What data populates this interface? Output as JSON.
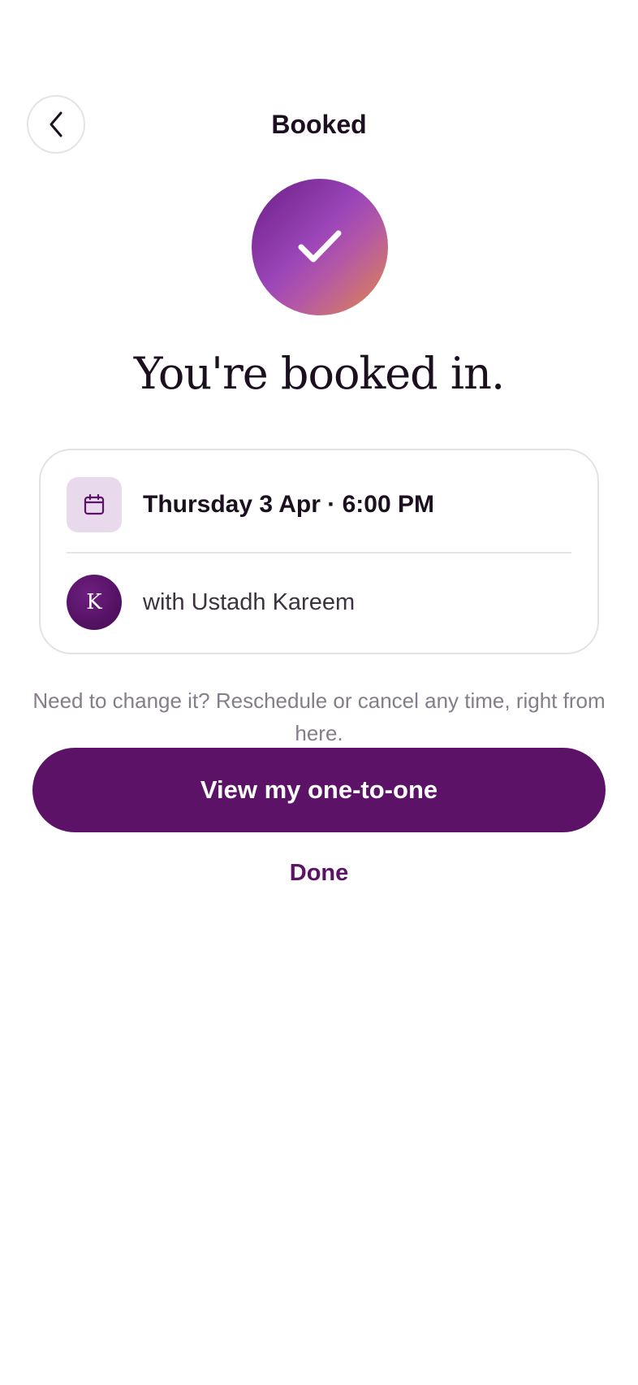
{
  "header": {
    "title": "Booked",
    "back_icon": "chevron-left-icon"
  },
  "confirmation": {
    "icon": "checkmark-icon",
    "heading": "You're booked in."
  },
  "booking": {
    "date_icon": "calendar-icon",
    "date_time": "Thursday 3 Apr · 6:00 PM",
    "tutor_initial": "K",
    "tutor_text": "with Ustadh Kareem"
  },
  "help_text": "Need to change it? Reschedule or cancel any time, right from here.",
  "actions": {
    "primary_label": "View my one-to-one",
    "secondary_label": "Done"
  },
  "colors": {
    "brand": "#5b1267",
    "calendar_tile": "#e8d9ec",
    "muted_text": "#857d89"
  }
}
